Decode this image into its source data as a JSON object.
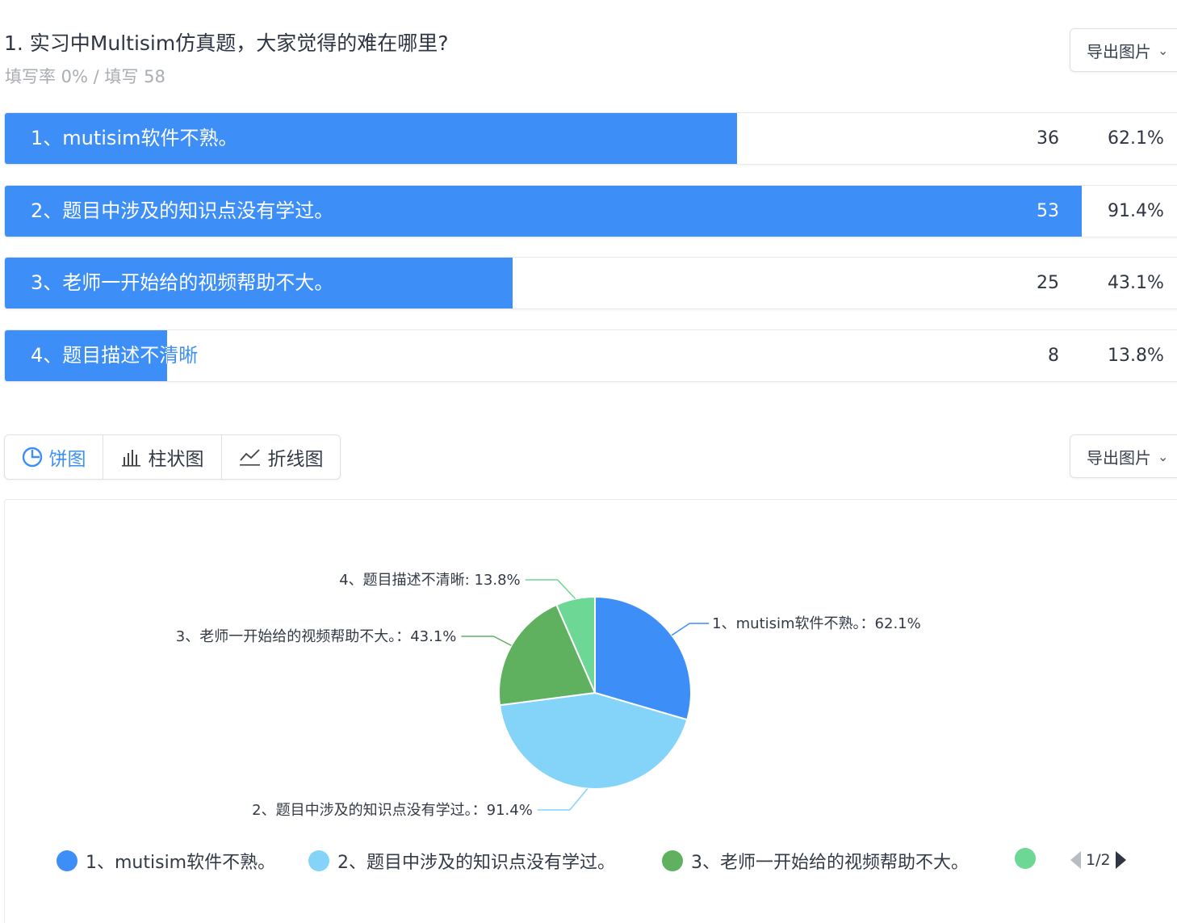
{
  "question": {
    "title": "1. 实习中Multisim仿真题，大家觉得的难在哪里?",
    "stats": "填写率 0% / 填写 58"
  },
  "export_label": "导出图片",
  "options": [
    {
      "label": "1、mutisim软件不熟。",
      "count": "36",
      "percent": "62.1%",
      "fill": 0.621
    },
    {
      "label": "2、题目中涉及的知识点没有学过。",
      "count": "53",
      "percent": "91.4%",
      "fill": 0.914
    },
    {
      "label": "3、老师一开始给的视频帮助不大。",
      "count": "25",
      "percent": "43.1%",
      "fill": 0.431
    },
    {
      "label": "4、题目描述不清晰",
      "count": "8",
      "percent": "13.8%",
      "fill": 0.138
    }
  ],
  "tabs": [
    {
      "label": "饼图",
      "icon": "pie-chart-icon",
      "active": true
    },
    {
      "label": "柱状图",
      "icon": "bar-chart-icon",
      "active": false
    },
    {
      "label": "折线图",
      "icon": "line-chart-icon",
      "active": false
    }
  ],
  "colors": {
    "accent": "#3e8ef7",
    "slices": [
      "#3e8ef7",
      "#84d4fa",
      "#5fb160",
      "#6dd796"
    ]
  },
  "chart_data": {
    "type": "pie",
    "categories": [
      "1、mutisim软件不熟。",
      "2、题目中涉及的知识点没有学过。",
      "3、老师一开始给的视频帮助不大。",
      "4、题目描述不清晰"
    ],
    "values": [
      36,
      53,
      25,
      8
    ],
    "slice_labels": [
      "1、mutisim软件不熟。：62.1%",
      "2、题目中涉及的知识点没有学过。：91.4%",
      "3、老师一开始给的视频帮助不大。：43.1%",
      "4、题目描述不清晰: 13.8%"
    ],
    "legend": {
      "position": "bottom",
      "items": [
        "1、mutisim软件不熟。",
        "2、题目中涉及的知识点没有学过。",
        "3、老师一开始给的视频帮助不大。",
        ""
      ],
      "page": "1/2"
    }
  }
}
